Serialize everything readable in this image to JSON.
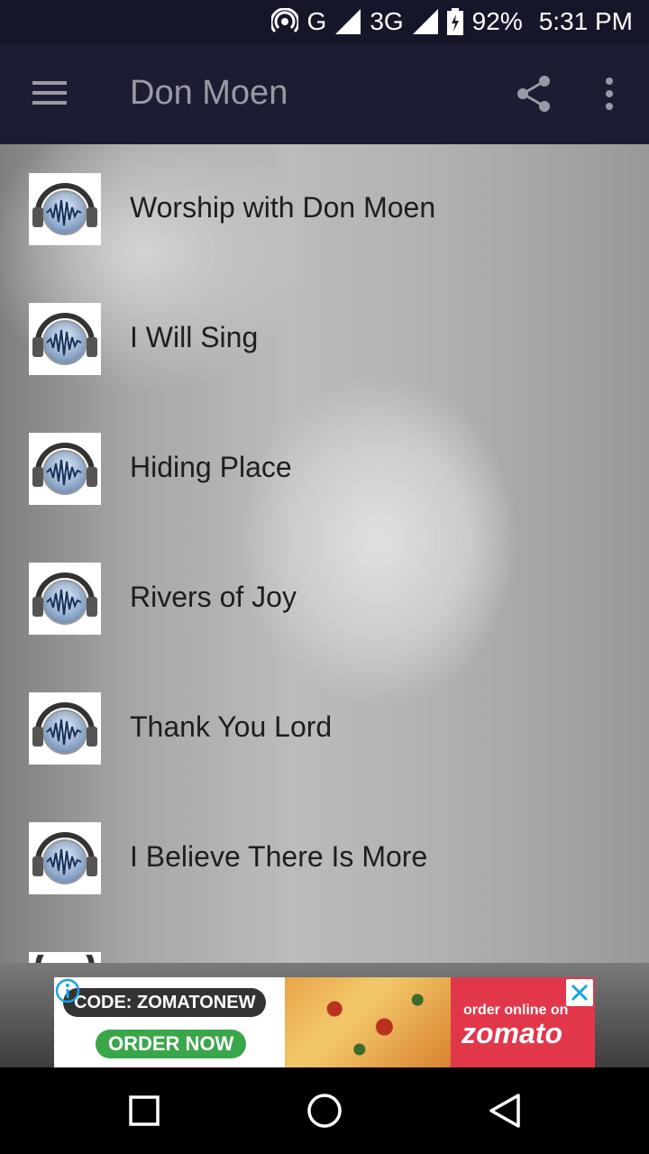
{
  "status_bar": {
    "network": "G",
    "network2": "3G",
    "battery": "92%",
    "time": "5:31 PM"
  },
  "app_bar": {
    "title": "Don Moen"
  },
  "songs": [
    {
      "label": "Worship with Don Moen"
    },
    {
      "label": "I Will Sing"
    },
    {
      "label": "Hiding Place"
    },
    {
      "label": "Rivers of Joy"
    },
    {
      "label": "Thank You Lord"
    },
    {
      "label": "I Believe There Is More"
    }
  ],
  "ad": {
    "code": "CODE: ZOMATONEW",
    "order": "ORDER NOW",
    "tagline": "order online on",
    "brand": "zomato"
  },
  "icons": {
    "menu": "hamburger-icon",
    "share": "share-icon",
    "more": "more-vert-icon",
    "thumb": "headphones-icon"
  }
}
